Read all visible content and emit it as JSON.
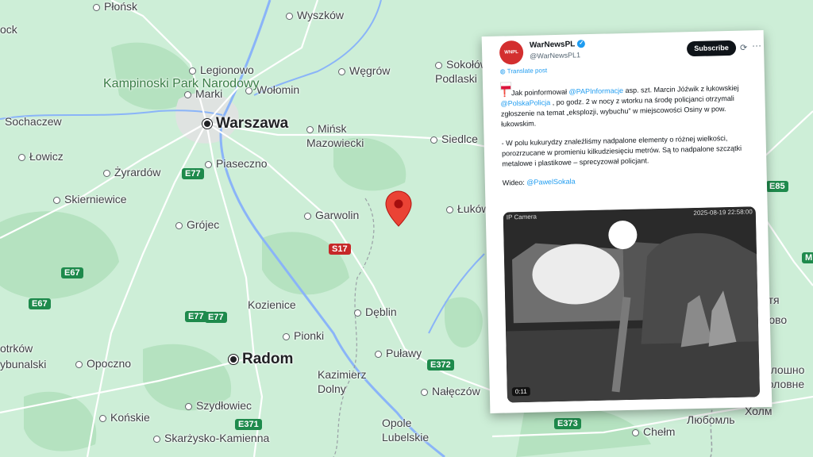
{
  "map": {
    "places": [
      {
        "name": "Płońsk",
        "cls": "small"
      },
      {
        "name": "Wyszków",
        "cls": "small"
      },
      {
        "name": "ock",
        "cls": "small"
      },
      {
        "name": "Legionowo",
        "cls": "small"
      },
      {
        "name": "Wołomin",
        "cls": "small"
      },
      {
        "name": "Węgrów",
        "cls": "small"
      },
      {
        "name": "Sokołów Podlaski",
        "cls": "small"
      },
      {
        "name": "Marki",
        "cls": "small"
      },
      {
        "name": "Warszawa",
        "cls": "big"
      },
      {
        "name": "Sochaczew",
        "cls": "small"
      },
      {
        "name": "Mińsk Mazowiecki",
        "cls": "small"
      },
      {
        "name": "Siedlce",
        "cls": "small"
      },
      {
        "name": "Łowicz",
        "cls": "small"
      },
      {
        "name": "Żyrardów",
        "cls": "small"
      },
      {
        "name": "Piaseczno",
        "cls": "small"
      },
      {
        "name": "Skierniewice",
        "cls": "small"
      },
      {
        "name": "Garwolin",
        "cls": "small"
      },
      {
        "name": "Łuków",
        "cls": "small"
      },
      {
        "name": "Grójec",
        "cls": "small"
      },
      {
        "name": "Kozienice",
        "cls": "small"
      },
      {
        "name": "Dęblin",
        "cls": "small"
      },
      {
        "name": "Pionki",
        "cls": "small"
      },
      {
        "name": "otrków",
        "cls": "small"
      },
      {
        "name": "ybunalski",
        "cls": "small"
      },
      {
        "name": "Opoczno",
        "cls": "small"
      },
      {
        "name": "Radom",
        "cls": "big"
      },
      {
        "name": "Puławy",
        "cls": "small"
      },
      {
        "name": "Kazimierz Dolny",
        "cls": "small"
      },
      {
        "name": "Nałęczów",
        "cls": "small"
      },
      {
        "name": "Szydłowiec",
        "cls": "small"
      },
      {
        "name": "Końskie",
        "cls": "small"
      },
      {
        "name": "Opole Lubelskie",
        "cls": "small"
      },
      {
        "name": "Skarżysko-Kamienna",
        "cls": "small"
      },
      {
        "name": "Chełm",
        "cls": "small"
      },
      {
        "name": "Холм",
        "cls": "small"
      },
      {
        "name": "іолошно",
        "cls": "small"
      },
      {
        "name": "лово",
        "cls": "small"
      },
      {
        "name": "Головне",
        "cls": "small"
      },
      {
        "name": "ятя",
        "cls": "small"
      },
      {
        "name": "Любомль",
        "cls": "small"
      }
    ],
    "park_label": "Kampinoski Park Narodowy",
    "roads": [
      "E77",
      "E77",
      "E77",
      "E67",
      "E67",
      "S17",
      "E372",
      "E373",
      "E371",
      "E85",
      "M"
    ]
  },
  "tweet": {
    "account_name": "WarNewsPL",
    "handle": "@WarNewsPL1",
    "subscribe_label": "Subscribe",
    "translate_label": "Translate post",
    "p1_a": "Jak poinformował ",
    "p1_m1": "@PAPInformacje",
    "p1_b": " asp. szt. Marcin Jóźwik z łukowskiej ",
    "p1_m2": "@PolskaPolicja",
    "p1_c": " , po godz. 2 w nocy z wtorku na środę policjanci otrzymali zgłoszenie na temat „eksplozji, wybuchu” w miejscowości Osiny w pow. łukowskim.",
    "p2": "- W polu kukurydzy znaleźliśmy nadpalone elementy o różnej wielkości, porozrzucane w promieniu kilkudziesięciu metrów. Są to nadpalone szczątki metalowe i plastikowe – sprecyzował policjant.",
    "p3_a": "Wideo: ",
    "p3_m": "@PawelSokala",
    "video": {
      "camera_label": "IP Camera",
      "timestamp": "2025-08-19 22:58:00",
      "duration": "0:11"
    }
  }
}
